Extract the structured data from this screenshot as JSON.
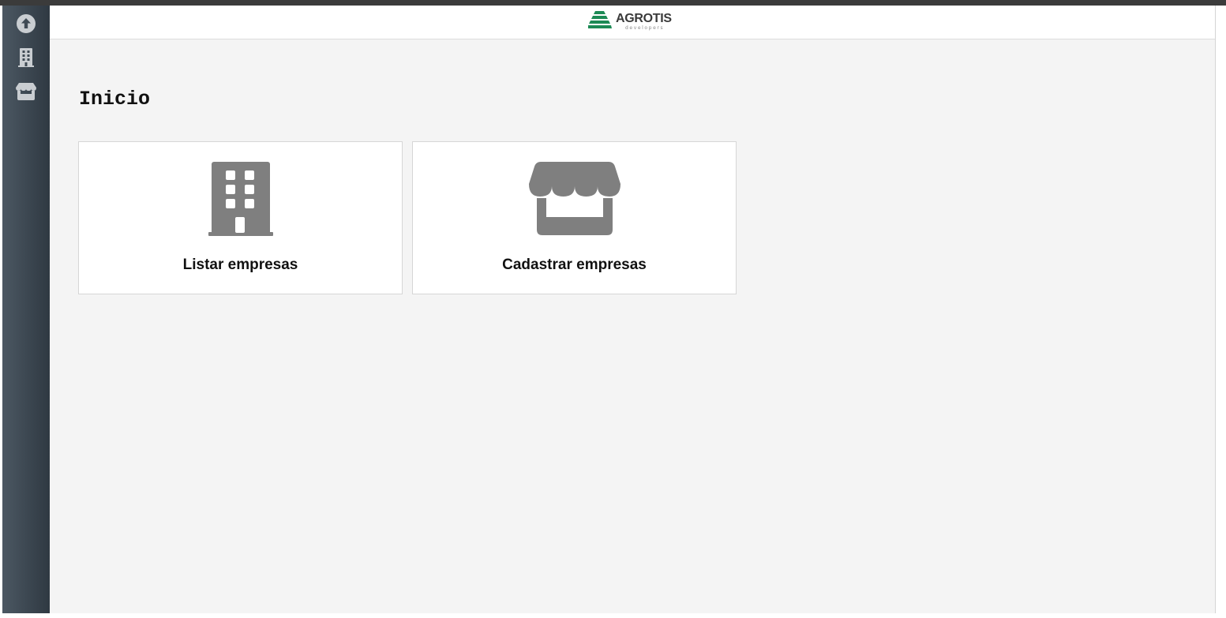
{
  "app": {
    "logo": {
      "name": "AGROTIS",
      "tagline": "developers",
      "brand_color": "#1d8a55"
    }
  },
  "sidebar": {
    "items": [
      {
        "icon": "arrow-up-circle-icon",
        "interactable": true
      },
      {
        "icon": "building-icon",
        "interactable": true
      },
      {
        "icon": "store-icon",
        "interactable": true
      }
    ],
    "background": "#3d4852",
    "icon_color": "#c9cdd1"
  },
  "main": {
    "page_title": "Inicio",
    "cards": [
      {
        "label": "Listar empresas",
        "icon": "building-icon"
      },
      {
        "label": "Cadastrar empresas",
        "icon": "store-icon"
      }
    ],
    "icon_color": "#7f7f7f",
    "background": "#f4f4f4"
  }
}
